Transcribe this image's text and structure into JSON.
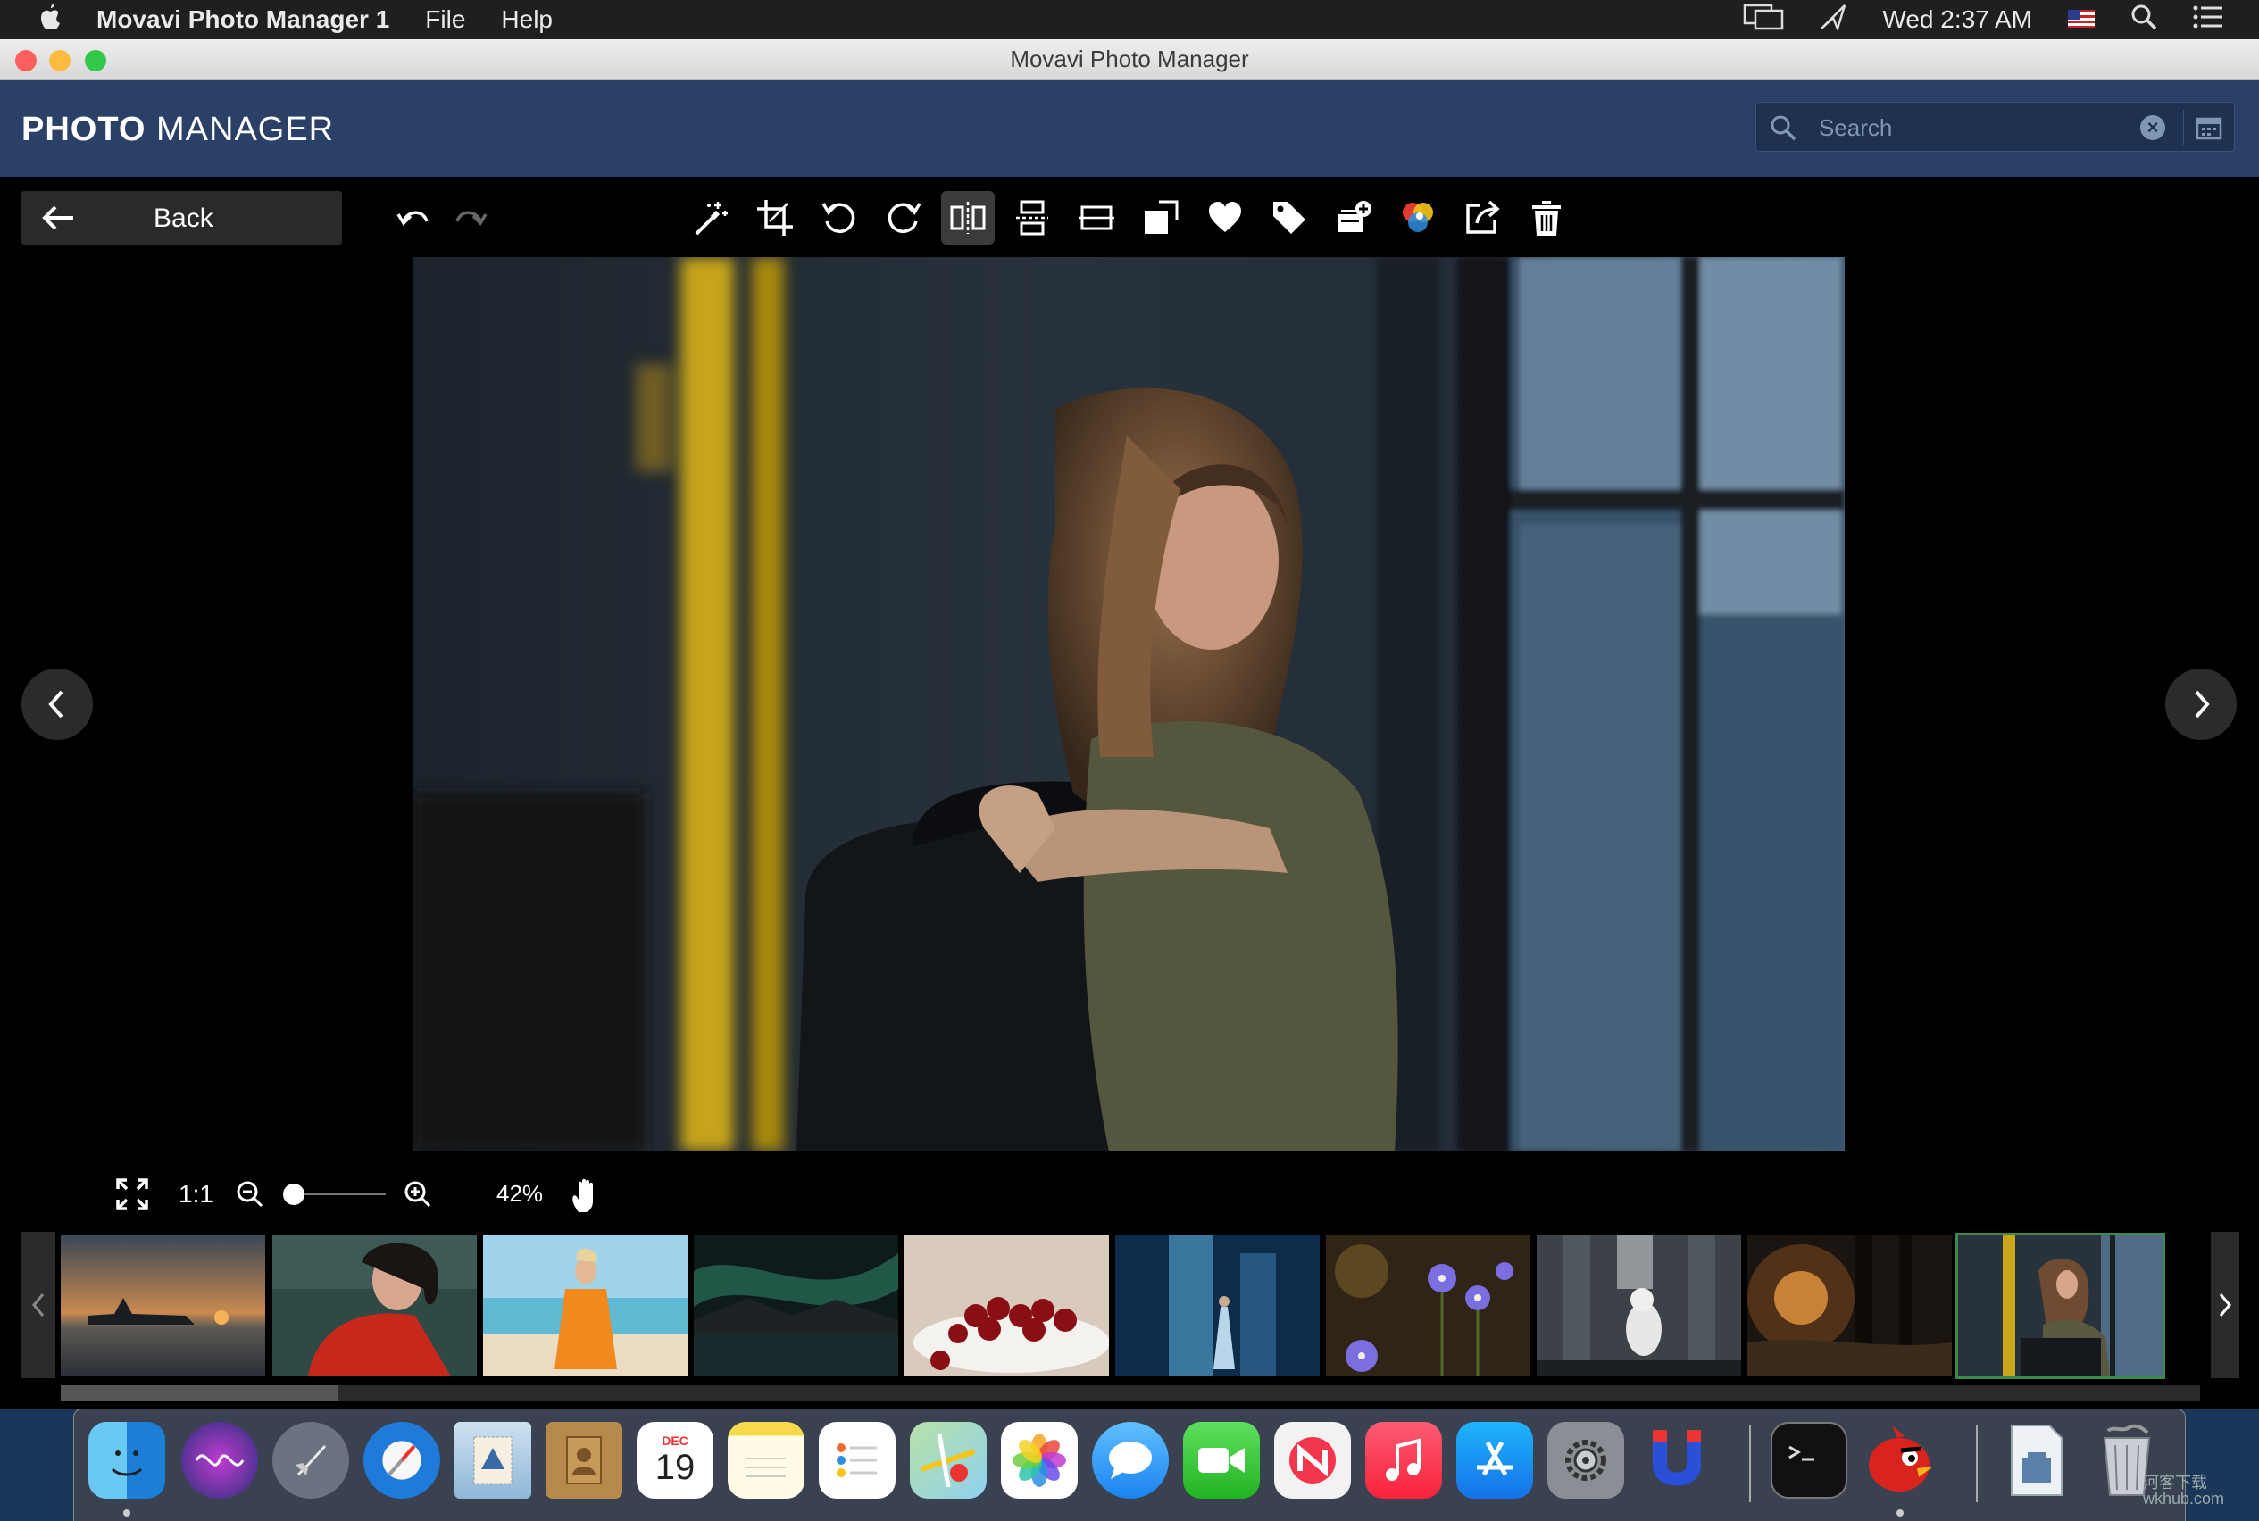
{
  "menubar": {
    "app_name": "Movavi Photo Manager 1",
    "menus": [
      "File",
      "Help"
    ],
    "clock": "Wed 2:37 AM"
  },
  "window": {
    "title": "Movavi Photo Manager"
  },
  "header": {
    "logo_bold": "PHOTO",
    "logo_light": " MANAGER",
    "search_placeholder": "Search"
  },
  "toolbar": {
    "back_label": "Back",
    "icons": [
      "undo-icon",
      "redo-icon",
      "magic-wand-icon",
      "crop-icon",
      "rotate-left-icon",
      "rotate-right-icon",
      "flip-horizontal-icon",
      "flip-vertical-icon",
      "straighten-icon",
      "resize-icon",
      "favorite-heart-icon",
      "tag-icon",
      "add-to-album-icon",
      "color-adjust-icon",
      "share-icon",
      "delete-trash-icon"
    ],
    "active_icon": "flip-horizontal-icon"
  },
  "zoom": {
    "ratio_label": "1:1",
    "percent": "42%",
    "slider_level": 0.08
  },
  "filmstrip": {
    "thumbnails": [
      "warship-at-sunset",
      "woman-red-dress",
      "woman-orange-dress-beach",
      "aurora-lake",
      "cherries-bowl",
      "waterfall-woman",
      "purple-flowers",
      "white-dog-forest",
      "forest-sunset",
      "woman-on-bus"
    ],
    "selected_index": 9,
    "scroll_fraction": 0.13
  },
  "dock": {
    "apps": [
      "Finder",
      "Siri",
      "Launchpad",
      "Safari",
      "Mail",
      "Contacts",
      "Calendar",
      "Notes",
      "Reminders",
      "Maps",
      "Photos",
      "Messages",
      "FaceTime",
      "News",
      "Music",
      "App Store",
      "System Preferences",
      "Magnet",
      "Terminal",
      "Angry Birds",
      "Preview",
      "Trash"
    ],
    "calendar_month": "DEC",
    "calendar_day": "19"
  },
  "watermark": {
    "line1": "河客下载",
    "line2": "wkhub.com"
  },
  "colors": {
    "header": "#2a4066",
    "accent_selected": "#3e8a4e",
    "search_bg": "#1f3151"
  }
}
